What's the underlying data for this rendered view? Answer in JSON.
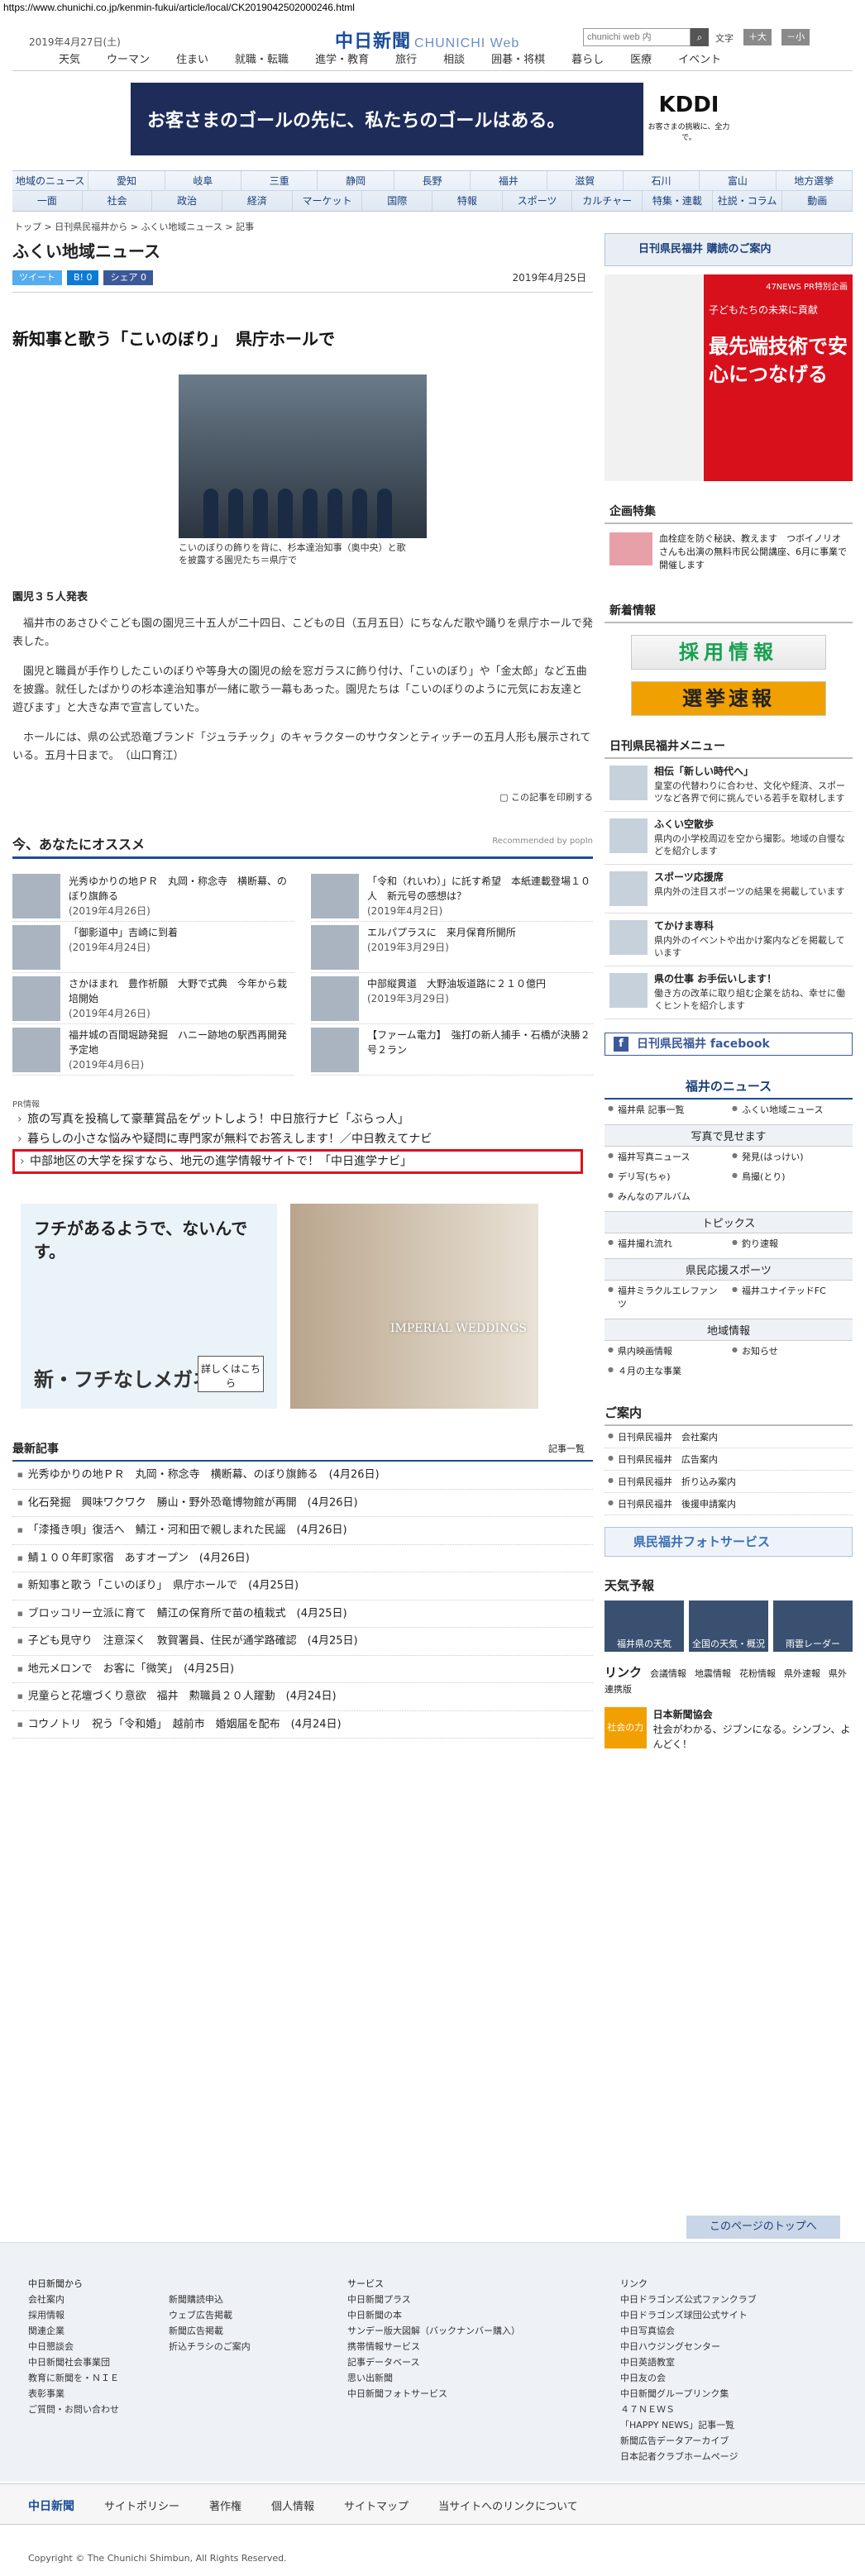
{
  "url": "https://www.chunichi.co.jp/kenmin-fukui/article/local/CK2019042502000246.html",
  "header": {
    "date": "2019年4月27日(土)",
    "logo": "中日新聞",
    "logo_sub": "CHUNICHI Web",
    "search_placeholder": "chunichi web 内",
    "font_label": "文字",
    "font_big": "＋大",
    "font_small": "－小"
  },
  "nav1": [
    "天気",
    "ウーマン",
    "住まい",
    "就職・転職",
    "進学・教育",
    "旅行",
    "相談",
    "囲碁・将棋",
    "暮らし",
    "医療",
    "イベント"
  ],
  "top_ad": {
    "copy": "お客さまのゴールの先に、私たちのゴールはある。",
    "brand": "KDDI",
    "note": "お客さまの挑戦に、全力で。"
  },
  "nav2_rows": [
    [
      "地域のニュース",
      "愛知",
      "岐阜",
      "三重",
      "静岡",
      "長野",
      "福井",
      "滋賀",
      "石川",
      "富山",
      "地方選挙"
    ],
    [
      "一面",
      "社会",
      "政治",
      "経済",
      "マーケット",
      "国際",
      "特報",
      "スポーツ",
      "カルチャー",
      "特集・連載",
      "社説・コラム",
      "動画"
    ]
  ],
  "breadcrumb": "トップ > 日刊県民福井から > ふくい地域ニュース > 記事",
  "section_title": "ふくい地域ニュース",
  "share": {
    "tweet": "ツイート",
    "hatena": "B! 0",
    "facebook": "シェア 0",
    "date": "2019年4月25日"
  },
  "article": {
    "headline": "新知事と歌う「こいのぼり」　県庁ホールで",
    "caption": "こいのぼりの飾りを背に、杉本達治知事（奥中央）と歌を披露する園児たち＝県庁で",
    "lead": "園児３５人発表",
    "paragraphs": [
      "福井市のあさひぐこども園の園児三十五人が二十四日、こどもの日（五月五日）にちなんだ歌や踊りを県庁ホールで発表した。",
      "園児と職員が手作りしたこいのぼりや等身大の園児の絵を窓ガラスに飾り付け、「こいのぼり」や「金太郎」など五曲を披露。就任したばかりの杉本達治知事が一緒に歌う一幕もあった。園児たちは「こいのぼりのように元気にお友達と遊びます」と大きな声で宣言していた。",
      "ホールには、県の公式恐竜ブランド「ジュラチック」のキャラクターのサウタンとティッチーの五月人形も展示されている。五月十日まで。　（山口育江）"
    ],
    "print": "この記事を印刷する"
  },
  "recommend": {
    "title": "今、あなたにオススメ",
    "powered": "Recommended by popIn",
    "items": [
      {
        "text": "光秀ゆかりの地ＰＲ　丸岡・称念寺　横断幕、のぼり旗飾る",
        "date": "(2019年4月26日)"
      },
      {
        "text": "「令和（れいわ）」に託す希望　本紙連載登場１０人　新元号の感想は？",
        "date": "(2019年4月2日)"
      },
      {
        "text": "「御影道中」吉崎に到着",
        "date": "(2019年4月24日)"
      },
      {
        "text": "エルパプラスに　来月保育所開所",
        "date": "(2019年3月29日)"
      },
      {
        "text": "さかほまれ　豊作祈願　大野で式典　今年から栽培開始",
        "date": "(2019年4月26日)"
      },
      {
        "text": "中部縦貫道　大野油坂道路に２１０億円",
        "date": "(2019年3月29日)"
      },
      {
        "text": "福井城の百間堀跡発掘　ハニー跡地の駅西再開発予定地",
        "date": "(2019年4月6日)"
      },
      {
        "text": "【ファーム電力】　強打の新人捕手・石橋が決勝２号２ラン",
        "date": ""
      }
    ]
  },
  "pr": {
    "label": "PR情報",
    "items": [
      "旅の写真を投稿して豪華賞品をゲットしよう！中日旅行ナビ「ぶらっ人」",
      "暮らしの小さな悩みや疑問に専門家が無料でお答えします！／中日教えてナビ",
      "中部地区の大学を探すなら、地元の進学情報サイトで！「中日進学ナビ」"
    ]
  },
  "ads": {
    "glasses_title": "フチがあるようで、ないんです。",
    "glasses_brand": "新・フチなしメガネ",
    "glasses_cta": "詳しくはこちら",
    "wedding": "IMPERIAL WEDDINGS"
  },
  "latest": {
    "title": "最新記事",
    "more": "記事一覧",
    "items": [
      "光秀ゆかりの地ＰＲ　丸岡・称念寺　横断幕、のぼり旗飾る　(4月26日)",
      "化石発掘　興味ワクワク　勝山・野外恐竜博物館が再開　(4月26日)",
      "「漆掻き唄」復活へ　鯖江・河和田で親しまれた民謡　(4月26日)",
      "鯖１００年町家宿　あすオープン　(4月26日)",
      "新知事と歌う「こいのぼり」　県庁ホールで　(4月25日)",
      "ブロッコリー立派に育て　鯖江の保育所で苗の植栽式　(4月25日)",
      "子ども見守り　注意深く　敦賀署員、住民が通学路確認　(4月25日)",
      "地元メロンで　お客に「微笑」　(4月25日)",
      "児童らと花壇づくり意欲　福井　勲職員２０人躍動　(4月24日)",
      "コウノトリ　祝う「令和婚」　越前市　婚姻届を配布　(4月24日)"
    ]
  },
  "side": {
    "subscribe": "日刊県民福井 購読のご案内",
    "ad47_pr": "47NEWS PR特別企画",
    "ad47_sub": "子どもたちの未来に貢献",
    "ad47_main": "最先端技術で安心につなげる",
    "feature_title": "企画特集",
    "feature_text": "血栓症を防ぐ秘訣、教えます　つボイノリオさんも出演の無料市民公開講座、6月に事業で開催します",
    "new_title": "新着情報",
    "saiyo": "採用情報",
    "senkyo": "選挙速報",
    "menu_title": "日刊県民福井メニュー",
    "menu": [
      {
        "h": "相伝「新しい時代へ」",
        "t": "皇室の代替わりに合わせ、文化や経済、スポーツなど各界で何に挑んでいる若手を取材します"
      },
      {
        "h": "ふくい空散歩",
        "t": "県内の小学校周辺を空から撮影。地域の自慢などを紹介します"
      },
      {
        "h": "スポーツ応援席",
        "t": "県内外の注目スポーツの結果を掲載しています"
      },
      {
        "h": "てかけま専科",
        "t": "県内外のイベントや出かけ案内などを掲載しています"
      },
      {
        "h": "県の仕事 お手伝いします！",
        "t": "働き方の改革に取り組む企業を訪ね、幸せに働くヒントを紹介します"
      }
    ],
    "facebook": "日刊県民福井 facebook",
    "news_title": "福井のニュース",
    "news_links": [
      "福井県 記事一覧",
      "ふくい地域ニュース"
    ],
    "photo_h": "写真で見せます",
    "photo_links": [
      "福井写真ニュース",
      "発見(はっけい)",
      "デリ写(ちゃ)",
      "鳥撮(とり)",
      "みんなのアルバム"
    ],
    "topics_h": "トピックス",
    "topics_links": [
      "福井撮れ流れ",
      "釣り速報"
    ],
    "sports_h": "県民応援スポーツ",
    "sports_links": [
      "福井ミラクルエレファンツ",
      "福井ユナイテッドFC"
    ],
    "info_h": "地域情報",
    "info_links": [
      "県内映画情報",
      "お知らせ",
      "４月の主な事業"
    ],
    "guide_title": "ご案内",
    "guide": [
      "日刊県民福井　会社案内",
      "日刊県民福井　広告案内",
      "日刊県民福井　折り込み案内",
      "日刊県民福井　後援申請案内"
    ],
    "photo_service": "県民福井フォトサービス",
    "wx_title": "天気予報",
    "wx": [
      "福井県の天気",
      "全国の天気・概況",
      "雨雲レーダー"
    ],
    "link_title": "リンク",
    "links": [
      "会議情報",
      "地震情報",
      "花粉情報",
      "県外速報",
      "県外連携版"
    ],
    "ad_text_h": "日本新聞協会",
    "ad_text": "社会がわかる、ジブンになる。シンブン、よんどく！",
    "ad_label": "社会の力"
  },
  "to_top": "このページのトップへ",
  "footer": {
    "col1_h": "中日新聞から",
    "col1": [
      "会社案内",
      "採用情報",
      "関連企業",
      "中日懇談会",
      "中日新聞社会事業団",
      "教育に新聞を・ＮＩＥ",
      "表彰事業",
      "ご質問・お問い合わせ"
    ],
    "col2": [
      "新聞購読申込",
      "ウェブ広告掲載",
      "新聞広告掲載",
      "折込チラシのご案内"
    ],
    "col3_h": "サービス",
    "col3": [
      "中日新聞プラス",
      "中日新聞の本",
      "サンデー版大図解（バックナンバー購入）",
      "携帯情報サービス",
      "記事データベース",
      "思い出新聞",
      "中日新聞フォトサービス"
    ],
    "col4_h": "リンク",
    "col4": [
      "中日ドラゴンズ公式ファンクラブ",
      "中日ドラゴンズ球団公式サイト",
      "中日写真協会",
      "中日ハウジングセンター",
      "中日英語教室",
      "中日友の会",
      "中日新聞グループリンク集",
      "４７ＮＥＷＳ",
      "「HAPPY NEWS」記事一覧",
      "新聞広告データアーカイブ",
      "日本記者クラブホームページ"
    ]
  },
  "bottom": {
    "logo": "中日新聞",
    "links": [
      "サイトポリシー",
      "著作権",
      "個人情報",
      "サイトマップ",
      "当サイトへのリンクについて"
    ],
    "copyright": "Copyright © The Chunichi Shimbun, All Rights Reserved."
  }
}
